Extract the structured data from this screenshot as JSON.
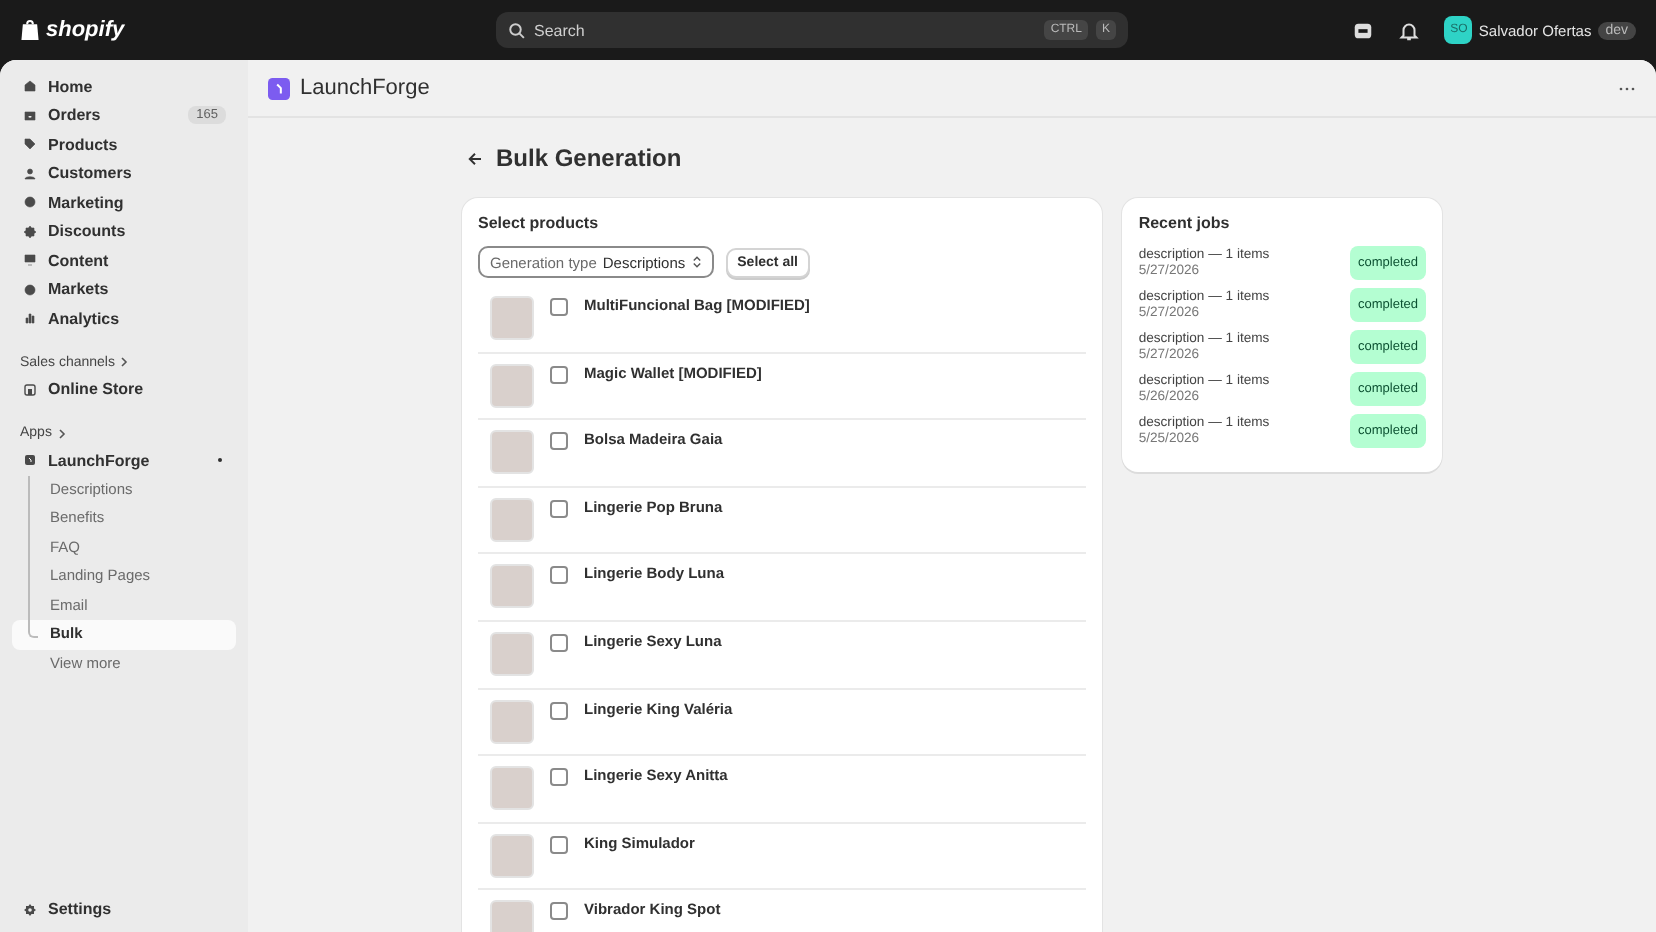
{
  "top_bar": {
    "logo": "shopify",
    "search": {
      "placeholder": "Search",
      "shortcut": [
        "CTRL",
        "K"
      ]
    },
    "user": {
      "initials": "SO",
      "name": "Salvador Ofertas",
      "badge": "dev"
    }
  },
  "sidebar": {
    "items": [
      {
        "label": "Home"
      },
      {
        "label": "Orders",
        "badge": "165"
      },
      {
        "label": "Products"
      },
      {
        "label": "Customers"
      },
      {
        "label": "Marketing"
      },
      {
        "label": "Discounts"
      },
      {
        "label": "Content"
      },
      {
        "label": "Markets"
      },
      {
        "label": "Analytics"
      }
    ],
    "sales_channels": {
      "heading": "Sales channels",
      "items": [
        {
          "label": "Online Store"
        }
      ]
    },
    "apps": {
      "heading": "Apps",
      "app": {
        "label": "LaunchForge",
        "children": [
          {
            "label": "Descriptions",
            "selected": false
          },
          {
            "label": "Benefits",
            "selected": false
          },
          {
            "label": "FAQ",
            "selected": false
          },
          {
            "label": "Landing Pages",
            "selected": false
          },
          {
            "label": "Email",
            "selected": false
          },
          {
            "label": "Bulk",
            "selected": true
          }
        ]
      },
      "view_more": "View more"
    },
    "settings": "Settings"
  },
  "app_header": {
    "title": "LaunchForge"
  },
  "page": {
    "title": "Bulk Generation",
    "select_card": {
      "title": "Select products",
      "select": {
        "label": "Generation type",
        "value": "Descriptions"
      },
      "select_all": "Select all",
      "products": [
        {
          "name": "MultiFuncional Bag [MODIFIED]",
          "checked": false
        },
        {
          "name": "Magic Wallet [MODIFIED]",
          "checked": false
        },
        {
          "name": "Bolsa Madeira Gaia",
          "checked": false
        },
        {
          "name": "Lingerie Pop Bruna",
          "checked": false
        },
        {
          "name": "Lingerie Body Luna",
          "checked": false
        },
        {
          "name": "Lingerie Sexy Luna",
          "checked": false
        },
        {
          "name": "Lingerie King Valéria",
          "checked": false
        },
        {
          "name": "Lingerie Sexy Anitta",
          "checked": false
        },
        {
          "name": "King Simulador",
          "checked": false
        },
        {
          "name": "Vibrador King Spot",
          "checked": false
        }
      ]
    },
    "jobs_card": {
      "title": "Recent jobs",
      "jobs": [
        {
          "summary": "description — 1 items",
          "date": "5/27/2026",
          "status": "completed"
        },
        {
          "summary": "description — 1 items",
          "date": "5/27/2026",
          "status": "completed"
        },
        {
          "summary": "description — 1 items",
          "date": "5/27/2026",
          "status": "completed"
        },
        {
          "summary": "description — 1 items",
          "date": "5/26/2026",
          "status": "completed"
        },
        {
          "summary": "description — 1 items",
          "date": "5/25/2026",
          "status": "completed"
        }
      ]
    }
  }
}
